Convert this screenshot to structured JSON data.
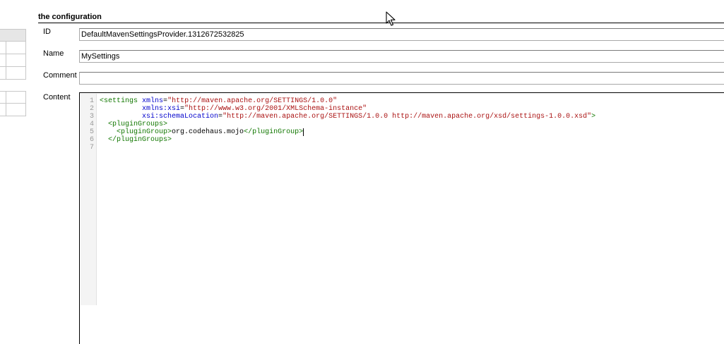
{
  "section": {
    "title": "the configuration"
  },
  "fields": {
    "id": {
      "label": "ID",
      "value": "DefaultMavenSettingsProvider.1312672532825"
    },
    "name": {
      "label": "Name",
      "value": "MySettings"
    },
    "comment": {
      "label": "Comment",
      "value": ""
    },
    "content": {
      "label": "Content"
    }
  },
  "editor": {
    "line_numbers": [
      "1",
      "2",
      "3",
      "4",
      "5",
      "6",
      "7"
    ],
    "lines": [
      [
        {
          "t": "tag",
          "v": "<settings"
        },
        {
          "t": "text",
          "v": " "
        },
        {
          "t": "attr",
          "v": "xmlns"
        },
        {
          "t": "text",
          "v": "="
        },
        {
          "t": "str",
          "v": "\"http://maven.apache.org/SETTINGS/1.0.0\""
        }
      ],
      [
        {
          "t": "text",
          "v": "          "
        },
        {
          "t": "attr",
          "v": "xmlns:xsi"
        },
        {
          "t": "text",
          "v": "="
        },
        {
          "t": "str",
          "v": "\"http://www.w3.org/2001/XMLSchema-instance\""
        }
      ],
      [
        {
          "t": "text",
          "v": "          "
        },
        {
          "t": "attr",
          "v": "xsi:schemaLocation"
        },
        {
          "t": "text",
          "v": "="
        },
        {
          "t": "str",
          "v": "\"http://maven.apache.org/SETTINGS/1.0.0 http://maven.apache.org/xsd/settings-1.0.0.xsd\""
        },
        {
          "t": "tag",
          "v": ">"
        }
      ],
      [
        {
          "t": "text",
          "v": "  "
        },
        {
          "t": "tag",
          "v": "<pluginGroups>"
        }
      ],
      [
        {
          "t": "text",
          "v": "    "
        },
        {
          "t": "tag",
          "v": "<pluginGroup>"
        },
        {
          "t": "text",
          "v": "org.codehaus.mojo"
        },
        {
          "t": "tag",
          "v": "</pluginGroup>"
        }
      ],
      [
        {
          "t": "text",
          "v": "  "
        },
        {
          "t": "tag",
          "v": "</pluginGroups>"
        }
      ],
      []
    ],
    "caret_line": 4
  },
  "colors": {
    "tag": "#117700",
    "attribute": "#0000cc",
    "string": "#aa1111",
    "gutter_background": "#f4f4f4"
  },
  "icons": {
    "mouse_cursor": "arrow-pointer-icon"
  }
}
